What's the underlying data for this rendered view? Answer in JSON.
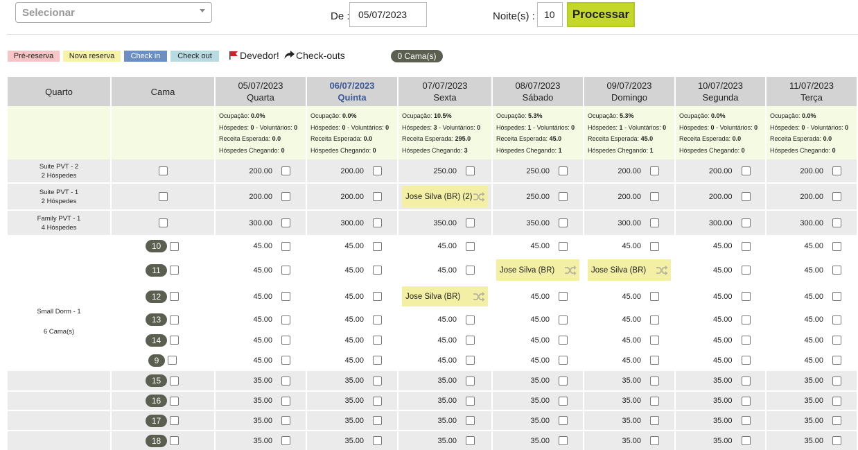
{
  "toolbar": {
    "select_placeholder": "Selecionar",
    "date_label": "De :",
    "date_value": "05/07/2023",
    "nights_label": "Noite(s) :",
    "nights_value": "10",
    "process_label": "Processar"
  },
  "legend": {
    "pre_reserva": "Pré-reserva",
    "nova_reserva": "Nova reserva",
    "check_in": "Check in",
    "check_out": "Check out",
    "devedor": "Devedor!",
    "check_outs": "Check-outs",
    "beds_count": "0 Cama(s)",
    "colors": {
      "pre_reserva": "#f7c5c5",
      "nova_reserva": "#f6f3a8",
      "check_in": "#6b8fc2",
      "check_out": "#b7dbe0"
    }
  },
  "table": {
    "col_quarto": "Quarto",
    "col_cama": "Cama",
    "days": [
      {
        "date": "05/07/2023",
        "weekday": "Quarta",
        "ocupacao": "0.0%",
        "hospedes": "0",
        "voluntarios": "0",
        "receita": "0.0",
        "chegando": "0"
      },
      {
        "date": "06/07/2023",
        "weekday": "Quinta",
        "ocupacao": "0.0%",
        "hospedes": "0",
        "voluntarios": "0",
        "receita": "0.0",
        "chegando": "0"
      },
      {
        "date": "07/07/2023",
        "weekday": "Sexta",
        "ocupacao": "10.5%",
        "hospedes": "3",
        "voluntarios": "0",
        "receita": "295.0",
        "chegando": "3"
      },
      {
        "date": "08/07/2023",
        "weekday": "Sábado",
        "ocupacao": "5.3%",
        "hospedes": "1",
        "voluntarios": "0",
        "receita": "45.0",
        "chegando": "1"
      },
      {
        "date": "09/07/2023",
        "weekday": "Domingo",
        "ocupacao": "5.3%",
        "hospedes": "1",
        "voluntarios": "0",
        "receita": "45.0",
        "chegando": "1"
      },
      {
        "date": "10/07/2023",
        "weekday": "Segunda",
        "ocupacao": "0.0%",
        "hospedes": "0",
        "voluntarios": "0",
        "receita": "0.0",
        "chegando": "0"
      },
      {
        "date": "11/07/2023",
        "weekday": "Terça",
        "ocupacao": "0.0%",
        "hospedes": "0",
        "voluntarios": "0",
        "receita": "0.0",
        "chegando": "0"
      }
    ],
    "stat_labels": {
      "ocupacao": "Ocupação:",
      "hospedes": "Hóspedes:",
      "voluntarios": "- Voluntários:",
      "receita": "Receita Esperada:",
      "chegando": "Hóspedes Chegando:"
    },
    "rooms": [
      {
        "name": "Suite PVT - 2",
        "sub": "2 Hóspedes"
      },
      {
        "name": "Suite PVT - 1",
        "sub": "2 Hóspedes"
      },
      {
        "name": "Family PVT - 1",
        "sub": "4 Hóspedes"
      },
      {
        "name": "Small Dorm - 1",
        "sub": "6 Cama(s)"
      }
    ],
    "rows": [
      {
        "room": 0,
        "bed": "",
        "prices": [
          "200.00",
          "200.00",
          "250.00",
          "250.00",
          "200.00",
          "200.00",
          "200.00"
        ]
      },
      {
        "room": 1,
        "bed": "",
        "prices": [
          "200.00",
          "200.00",
          "",
          "250.00",
          "200.00",
          "200.00",
          "200.00"
        ]
      },
      {
        "room": 2,
        "bed": "",
        "prices": [
          "300.00",
          "300.00",
          "350.00",
          "350.00",
          "300.00",
          "300.00",
          "300.00"
        ]
      },
      {
        "bed": "10",
        "prices": [
          "45.00",
          "45.00",
          "45.00",
          "45.00",
          "45.00",
          "45.00",
          "45.00"
        ]
      },
      {
        "bed": "11",
        "prices": [
          "45.00",
          "45.00",
          "45.00",
          "",
          "",
          "45.00",
          "45.00"
        ]
      },
      {
        "bed": "12",
        "prices": [
          "45.00",
          "45.00",
          "",
          "45.00",
          "45.00",
          "45.00",
          "45.00"
        ]
      },
      {
        "bed": "13",
        "prices": [
          "45.00",
          "45.00",
          "45.00",
          "45.00",
          "45.00",
          "45.00",
          "45.00"
        ]
      },
      {
        "bed": "14",
        "prices": [
          "45.00",
          "45.00",
          "45.00",
          "45.00",
          "45.00",
          "45.00",
          "45.00"
        ]
      },
      {
        "bed": "9",
        "prices": [
          "45.00",
          "45.00",
          "45.00",
          "45.00",
          "45.00",
          "45.00",
          "45.00"
        ]
      },
      {
        "bed": "15",
        "prices": [
          "35.00",
          "35.00",
          "35.00",
          "35.00",
          "35.00",
          "35.00",
          "35.00"
        ]
      },
      {
        "bed": "16",
        "prices": [
          "35.00",
          "35.00",
          "35.00",
          "35.00",
          "35.00",
          "35.00",
          "35.00"
        ]
      },
      {
        "bed": "17",
        "prices": [
          "35.00",
          "35.00",
          "35.00",
          "35.00",
          "35.00",
          "35.00",
          "35.00"
        ]
      },
      {
        "bed": "18",
        "prices": [
          "35.00",
          "35.00",
          "35.00",
          "35.00",
          "35.00",
          "35.00",
          "35.00"
        ]
      }
    ],
    "bookings": [
      {
        "row": 1,
        "day": 2,
        "guest": "Jose Silva (BR) (2)"
      },
      {
        "row": 4,
        "day": 3,
        "guest": "Jose Silva (BR)"
      },
      {
        "row": 4,
        "day": 4,
        "guest": "Jose Silva (BR)"
      },
      {
        "row": 5,
        "day": 2,
        "guest": "Jose Silva (BR)"
      }
    ]
  }
}
